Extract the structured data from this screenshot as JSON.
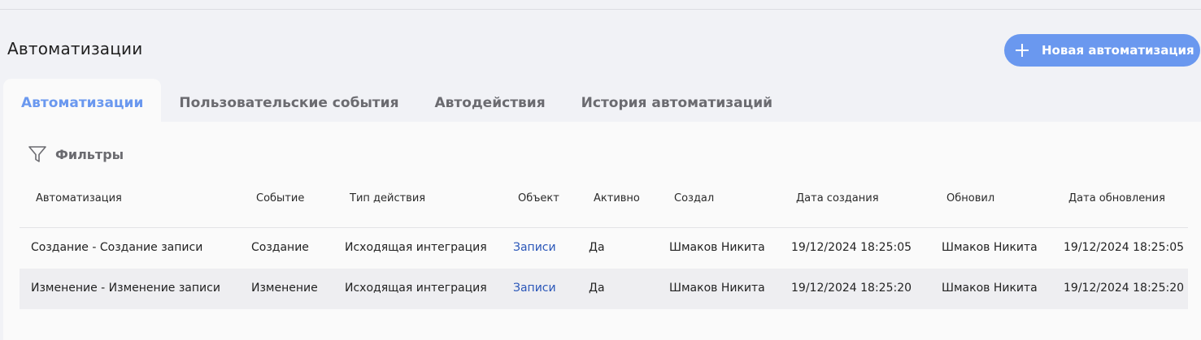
{
  "header": {
    "title": "Автоматизации",
    "new_button_label": "Новая автоматизация"
  },
  "tabs": [
    {
      "label": "Автоматизации",
      "active": true
    },
    {
      "label": "Пользовательские события",
      "active": false
    },
    {
      "label": "Автодействия",
      "active": false
    },
    {
      "label": "История автоматизаций",
      "active": false
    }
  ],
  "filters": {
    "label": "Фильтры",
    "icon": "filter-icon"
  },
  "table": {
    "columns": [
      "Автоматизация",
      "Событие",
      "Тип действия",
      "Объект",
      "Активно",
      "Создал",
      "Дата создания",
      "Обновил",
      "Дата обновления"
    ],
    "rows": [
      [
        "Создание - Создание записи",
        "Создание",
        "Исходящая интеграция",
        "Записи",
        "Да",
        "Шмаков Никита",
        "19/12/2024 18:25:05",
        "Шмаков Никита",
        "19/12/2024 18:25:05"
      ],
      [
        "Изменение - Изменение записи",
        "Изменение",
        "Исходящая интеграция",
        "Записи",
        "Да",
        "Шмаков Никита",
        "19/12/2024 18:25:20",
        "Шмаков Никита",
        "19/12/2024 18:25:20"
      ]
    ]
  },
  "colors": {
    "accent": "#6a98ef",
    "link": "#2a56b8"
  }
}
